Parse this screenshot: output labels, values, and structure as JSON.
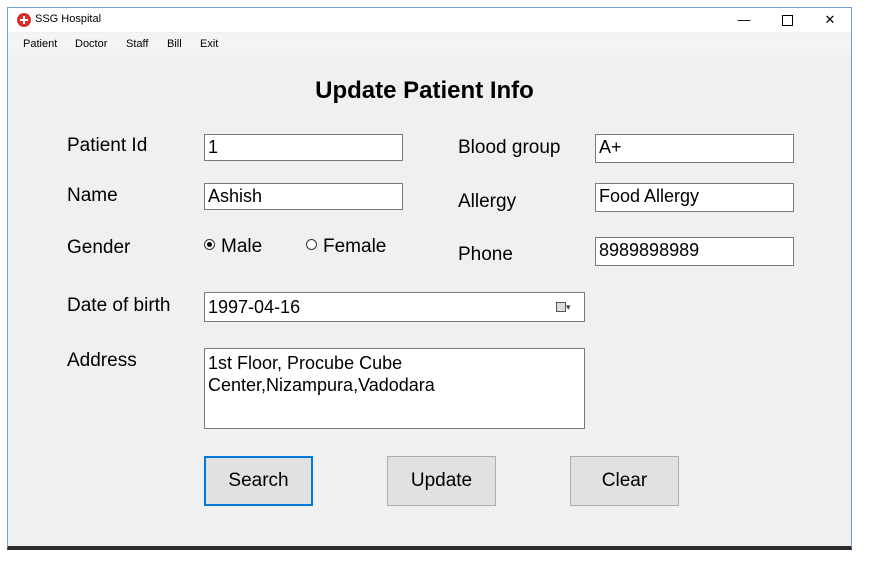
{
  "window": {
    "title": "SSG Hospital",
    "controls": {
      "minimize": "—",
      "close": "✕"
    }
  },
  "menu": [
    "Patient",
    "Doctor",
    "Staff",
    "Bill",
    "Exit"
  ],
  "form": {
    "heading": "Update Patient Info",
    "labels": {
      "patient_id": "Patient Id",
      "name": "Name",
      "gender": "Gender",
      "dob": "Date of birth",
      "address": "Address",
      "blood_group": "Blood group",
      "allergy": "Allergy",
      "phone": "Phone"
    },
    "values": {
      "patient_id": "1",
      "name": "Ashish",
      "blood_group": "A+",
      "allergy": "Food Allergy",
      "phone": "8989898989",
      "dob": "1997-04-16",
      "address_line1": "1st Floor, Procube Cube",
      "address_line2": "Center,Nizampura,Vadodara"
    },
    "gender_options": {
      "male": "Male",
      "female": "Female",
      "selected": "Male"
    }
  },
  "buttons": {
    "search": "Search",
    "update": "Update",
    "clear": "Clear"
  },
  "colors": {
    "accent": "#0078d7",
    "window_bg": "#f0f0f0",
    "icon_red": "#d32f2f"
  }
}
